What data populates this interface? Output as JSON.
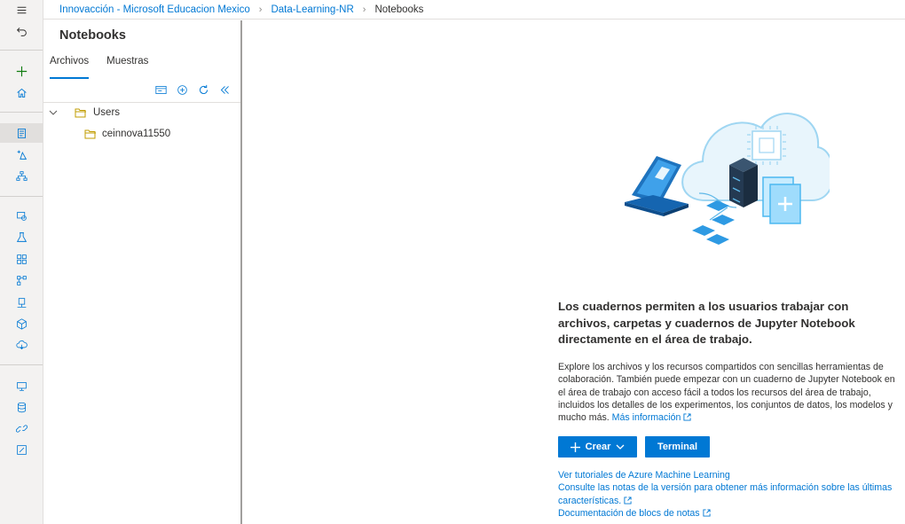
{
  "breadcrumb": {
    "workspace": "Innovacción - Microsoft Educacion Mexico",
    "resource": "Data-Learning-NR",
    "current": "Notebooks"
  },
  "nav_rail": {
    "icons": [
      "menu-icon",
      "back-icon",
      "add-icon",
      "home-icon",
      "notebooks-icon",
      "automl-icon",
      "designer-icon",
      "datasets-icon",
      "experiments-icon",
      "pipelines-icon",
      "models-icon",
      "endpoints-icon",
      "compute-icon",
      "datastores-icon",
      "linked-services-icon",
      "labeling-icon"
    ]
  },
  "panel": {
    "title": "Notebooks",
    "tabs": [
      {
        "label": "Archivos",
        "selected": true
      },
      {
        "label": "Muestras",
        "selected": false
      }
    ],
    "tree": [
      {
        "label": "Users",
        "level": 0,
        "expanded": true
      },
      {
        "label": "ceinnova11550",
        "level": 1,
        "expanded": false
      }
    ]
  },
  "main": {
    "headline": "Los cuadernos permiten a los usuarios trabajar con archivos, carpetas y cuadernos de Jupyter Notebook directamente en el área de trabajo.",
    "description": "Explore los archivos y los recursos compartidos con sencillas herramientas de colaboración. También puede empezar con un cuaderno de Jupyter Notebook en el área de trabajo con acceso fácil a todos los recursos del área de trabajo, incluidos los detalles de los experimentos, los conjuntos de datos, los modelos y mucho más.",
    "more_info": "Más información",
    "create_button": "Crear",
    "terminal_button": "Terminal",
    "links": [
      "Ver tutoriales de Azure Machine Learning",
      "Consulte las notas de la versión para obtener más información sobre las últimas características.",
      "Documentación de blocs de notas"
    ]
  },
  "colors": {
    "accent": "#0078d4",
    "folder": "#c19c00"
  }
}
